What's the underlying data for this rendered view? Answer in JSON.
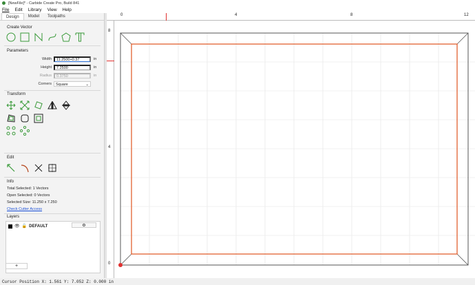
{
  "window": {
    "title": "[NewFile]* - Carbide Create Pro, Build 8​41"
  },
  "menu": [
    "File",
    "Edit",
    "Library",
    "View",
    "Help"
  ],
  "tabs": [
    "Design",
    "Model",
    "Toolpaths"
  ],
  "sections": {
    "create_vector": "Create Vector",
    "parameters": "Parameters",
    "transform": "Transform",
    "edit": "Edit",
    "info": "Info",
    "layers": "Layers"
  },
  "create_icons": [
    "circle-icon",
    "rectangle-icon",
    "polyline-icon",
    "curve-icon",
    "polygon-icon",
    "text-icon"
  ],
  "params": {
    "width_label": "Width",
    "width_value": "11.2500+0.37",
    "width_unit": "in",
    "height_label": "Height",
    "height_value": "7.2500",
    "height_unit": "in",
    "radius_label": "Radius",
    "radius_value": "0.3750",
    "radius_unit": "in",
    "corners_label": "Corners",
    "corners_value": "Square"
  },
  "info": {
    "total_selected": "Total Selected:   1 Vectors",
    "open_selected": "Open Selected:   0 Vectors",
    "selected_size": "Selected Size:    11.250 x 7.250",
    "link": "Check Cutter Access"
  },
  "layers": {
    "default_name": "DEFAULT",
    "add_label": "+",
    "gear": "⚙"
  },
  "ruler": {
    "h": [
      "0",
      "4",
      "8",
      "12"
    ],
    "v": [
      "8",
      "4",
      "0"
    ]
  },
  "status": "Cursor Position X: 1.561 Y: 7.052 Z: 0.000 in",
  "colors": {
    "accent": "#e0531f",
    "icon_green": "#3a9a3a",
    "link": "#1a4fd6"
  }
}
